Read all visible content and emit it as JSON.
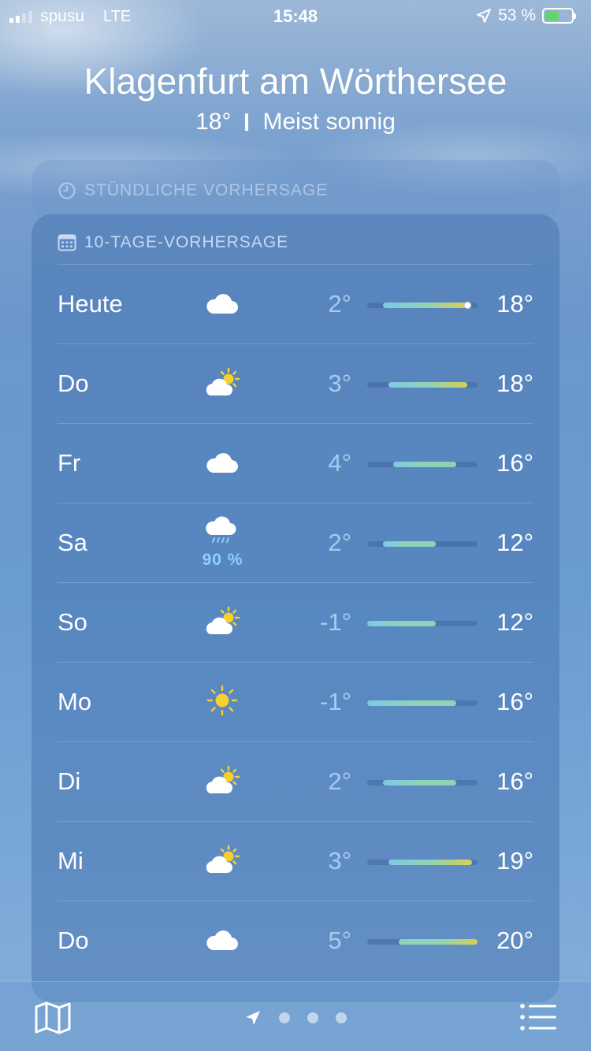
{
  "status_bar": {
    "carrier": "spusu",
    "network": "LTE",
    "time": "15:48",
    "battery": "53 %",
    "battery_level": 0.53
  },
  "header": {
    "city": "Klagenfurt am Wörthersee",
    "temperature": "18°",
    "condition": "Meist sonnig"
  },
  "hourly": {
    "title": "STÜNDLICHE VORHERSAGE",
    "icon": "clock-icon"
  },
  "daily": {
    "title": "10-TAGE-VORHERSAGE",
    "icon": "calendar-icon",
    "range_min": -1,
    "range_max": 20,
    "days": [
      {
        "day": "Heute",
        "icon": "cloud",
        "precip": "",
        "low": "2°",
        "high": "18°",
        "low_val": 2,
        "high_val": 18,
        "current": 18
      },
      {
        "day": "Do",
        "icon": "partly-sunny",
        "precip": "",
        "low": "3°",
        "high": "18°",
        "low_val": 3,
        "high_val": 18
      },
      {
        "day": "Fr",
        "icon": "cloud",
        "precip": "",
        "low": "4°",
        "high": "16°",
        "low_val": 4,
        "high_val": 16
      },
      {
        "day": "Sa",
        "icon": "rain",
        "precip": "90 %",
        "low": "2°",
        "high": "12°",
        "low_val": 2,
        "high_val": 12
      },
      {
        "day": "So",
        "icon": "partly-sunny",
        "precip": "",
        "low": "-1°",
        "high": "12°",
        "low_val": -1,
        "high_val": 12
      },
      {
        "day": "Mo",
        "icon": "sun",
        "precip": "",
        "low": "-1°",
        "high": "16°",
        "low_val": -1,
        "high_val": 16
      },
      {
        "day": "Di",
        "icon": "partly-sunny",
        "precip": "",
        "low": "2°",
        "high": "16°",
        "low_val": 2,
        "high_val": 16
      },
      {
        "day": "Mi",
        "icon": "partly-sunny",
        "precip": "",
        "low": "3°",
        "high": "19°",
        "low_val": 3,
        "high_val": 19
      },
      {
        "day": "Do",
        "icon": "cloud",
        "precip": "",
        "low": "5°",
        "high": "20°",
        "low_val": 5,
        "high_val": 20
      }
    ]
  },
  "bottom_bar": {
    "map_icon": "map-icon",
    "location_icon": "location-arrow-icon",
    "page_count": 3,
    "list_icon": "list-icon"
  },
  "colors": {
    "cool": "#7fc8e6",
    "mild": "#8fd3b6",
    "warm": "#d6cf55",
    "precip": "#8ed0ff",
    "sun": "#f7cf2f"
  }
}
